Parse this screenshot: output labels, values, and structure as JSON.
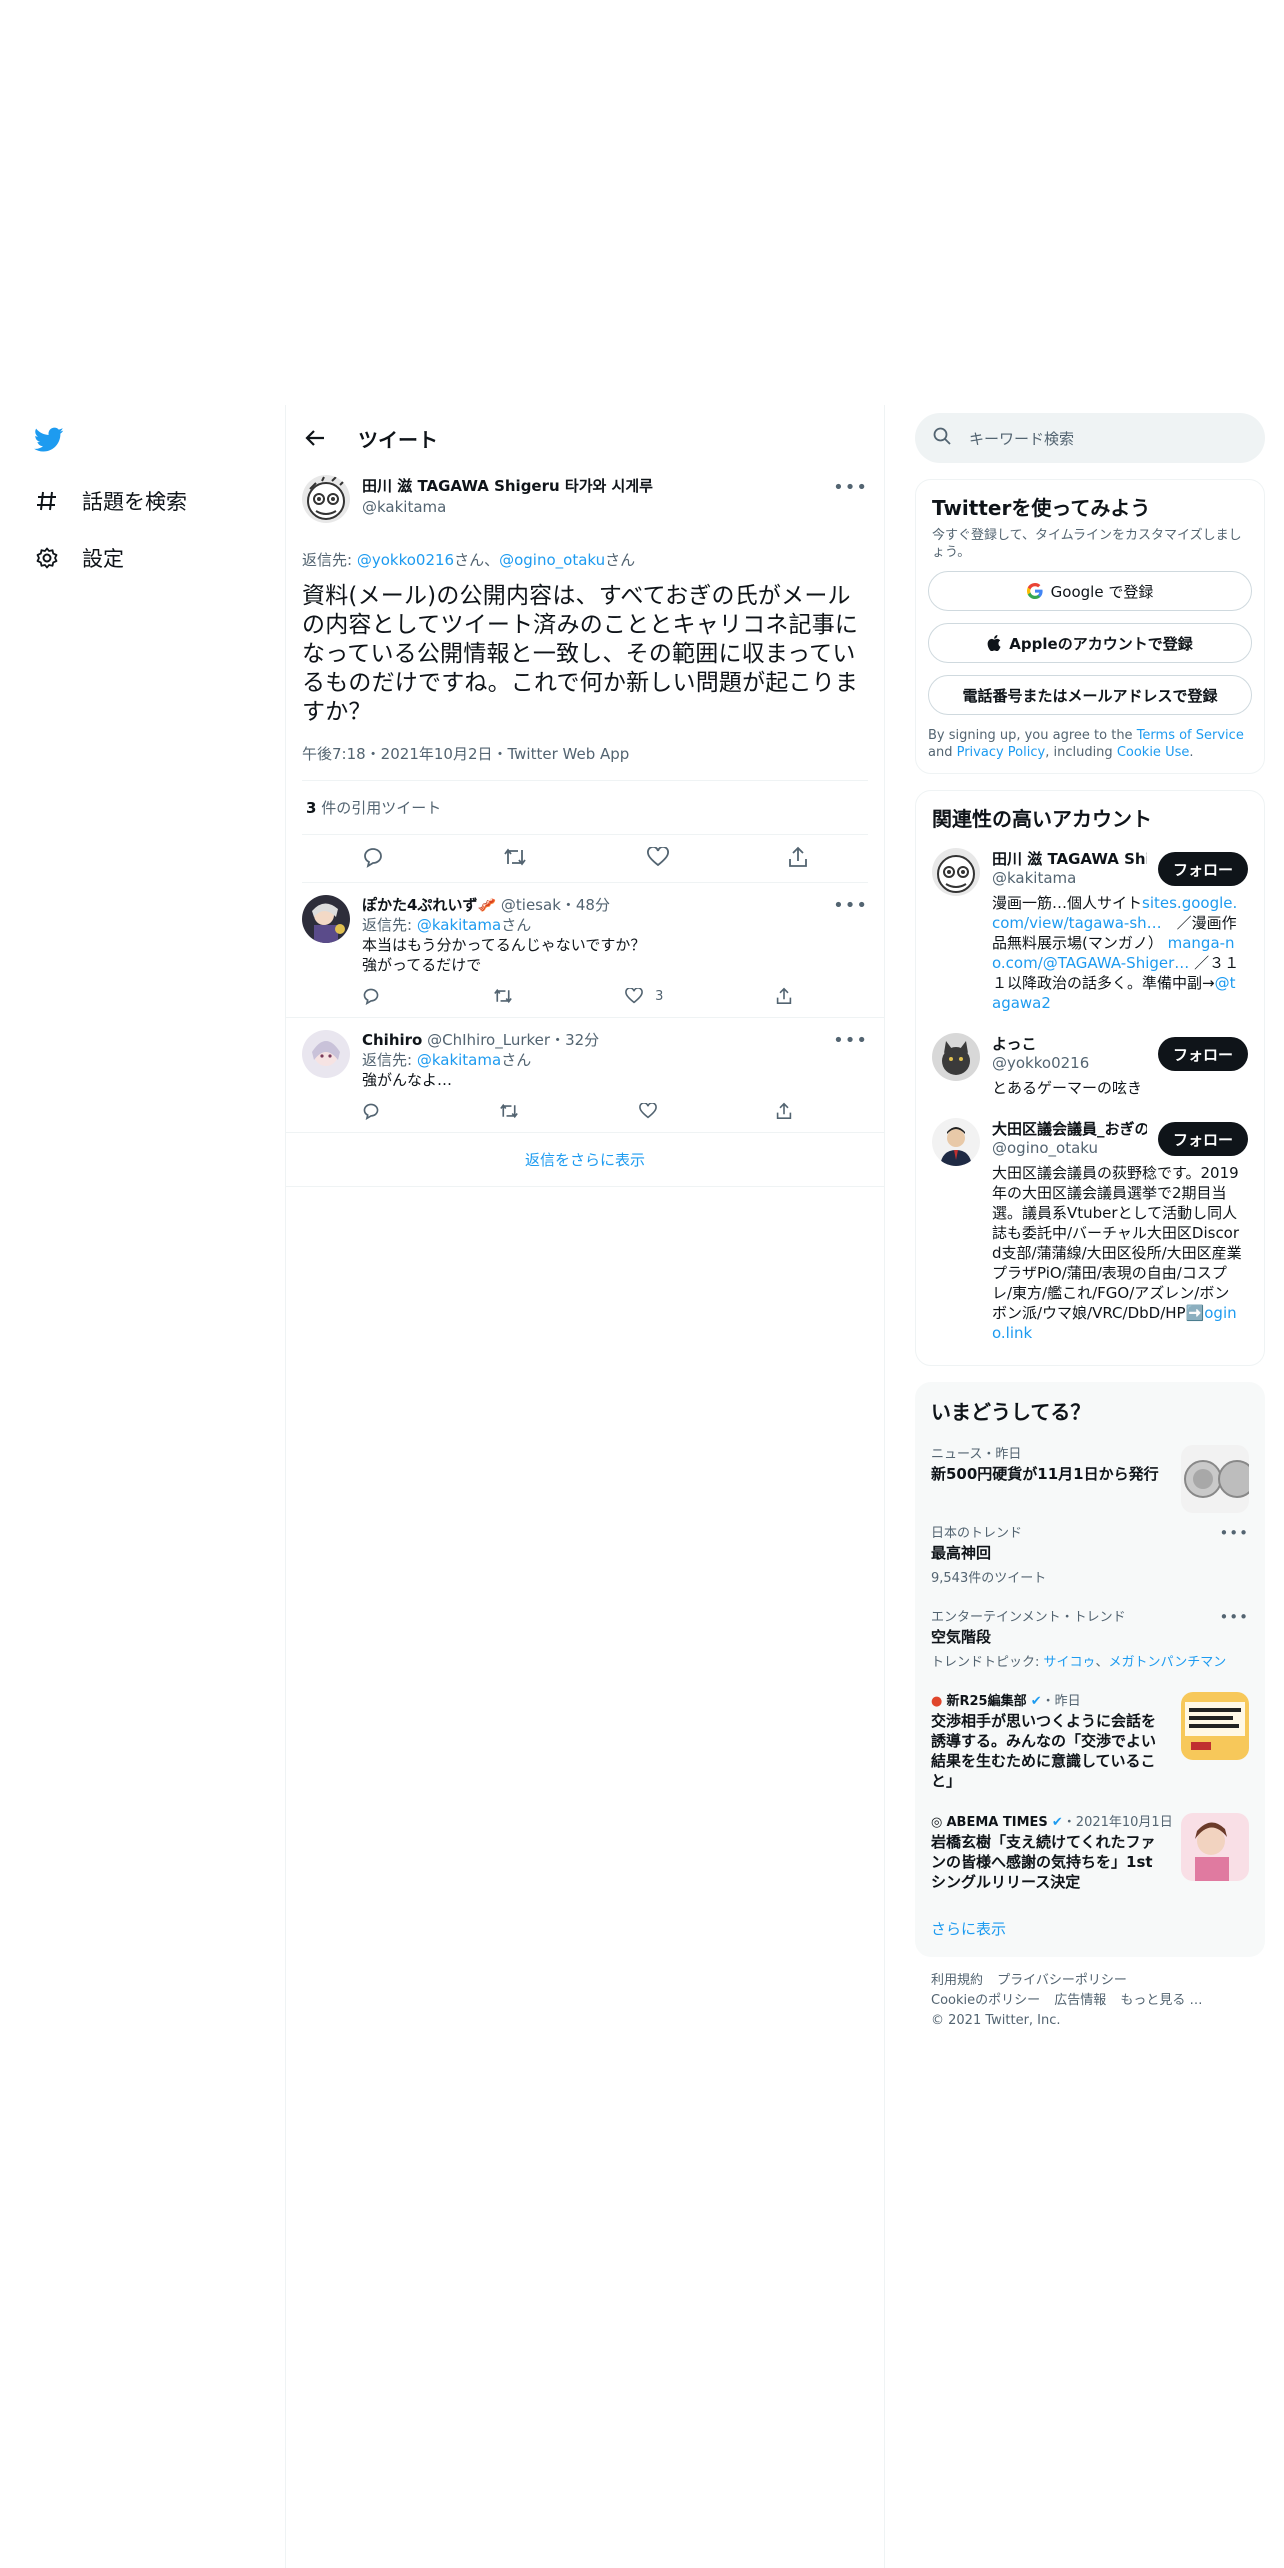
{
  "nav": {
    "explore": "話題を検索",
    "settings": "設定"
  },
  "header": {
    "title": "ツイート"
  },
  "tweet": {
    "author_name": "田川 滋 TAGAWA Shigeru 타가와 시게루",
    "author_handle": "@kakitama",
    "replying_prefix": "返信先: ",
    "replying_to_1": "@yokko0216",
    "replying_san_1": "さん、",
    "replying_to_2": "@ogino_otaku",
    "replying_san_2": "さん",
    "text": "資料(メール)の公開内容は、すべておぎの氏がメールの内容としてツイート済みのこととキャリコネ記事になっている公開情報と一致し、その範囲に収まっているものだけですね。これで何か新しい問題が起こりますか？",
    "timestamp": "午後7:18・2021年10月2日・Twitter Web App",
    "quote_count": "3",
    "quote_label": " 件の引用ツイート"
  },
  "replies": [
    {
      "name": "ぽかた4ぷれいず🥓",
      "handle": "@tiesak",
      "time": "・48分",
      "replying_prefix": "返信先: ",
      "replying_to": "@kakitama",
      "replying_san": "さん",
      "text_1": "本当はもう分かってるんじゃないですか？",
      "text_2": "強がってるだけで",
      "like_count": "3"
    },
    {
      "name": "Chihiro",
      "handle": "@ChIhiro_Lurker",
      "time": "・32分",
      "replying_prefix": "返信先: ",
      "replying_to": "@kakitama",
      "replying_san": "さん",
      "text_1": "強がんなよ…",
      "like_count": ""
    }
  ],
  "show_more_replies": "返信をさらに表示",
  "search": {
    "placeholder": "キーワード検索"
  },
  "signup": {
    "title": "Twitterを使ってみよう",
    "subtitle": "今すぐ登録して、タイムラインをカスタマイズしましょう。",
    "google": "Google で登録",
    "apple": "Appleのアカウントで登録",
    "phone_email": "電話番号またはメールアドレスで登録",
    "legal_1": "By signing up, you agree to the ",
    "terms": "Terms of Service",
    "legal_2": " and ",
    "privacy": "Privacy Policy",
    "legal_3": ", including ",
    "cookie": "Cookie Use",
    "legal_4": "."
  },
  "related": {
    "title": "関連性の高いアカウント",
    "follow_label": "フォロー",
    "accounts": [
      {
        "name": "田川 滋 TAGAWA Shigeru 타가와 시게루",
        "handle": "@kakitama",
        "bio_1": "漫画一筋…個人サイト",
        "bio_link_1": "sites.google.com/view/tagawa-sh…",
        "bio_2": "　／漫画作品無料展示場(マンガノ） ",
        "bio_link_2": "manga-no.com/@TAGAWA-Shiger…",
        "bio_3": " ／３１１以降政治の話多く。準備中副→",
        "bio_link_3": "@tagawa2"
      },
      {
        "name": "よっこ",
        "handle": "@yokko0216",
        "bio_1": "とあるゲーマーの呟き"
      },
      {
        "name": "大田区議会議員_おぎの稔",
        "handle": "@ogino_otaku",
        "bio_1": "大田区議会議員の荻野稔です。2019年の大田区議会議員選挙で2期目当選。議員系Vtuberとして活動し同人誌も委託中/バーチャル大田区Discord支部/蒲蒲線/大田区役所/大田区産業プラザPiO/蒲田/表現の自由/コスプレ/東方/艦これ/FGO/アズレン/ボンボン派/ウマ娘/VRC/DbD/HP➡️",
        "bio_link_1": "ogino.link"
      }
    ]
  },
  "trends": {
    "title": "いまどうしてる？",
    "items": [
      {
        "category": "ニュース・昨日",
        "title": "新500円硬貨が11月1日から発行"
      },
      {
        "category": "日本のトレンド",
        "title": "最高神回",
        "count": "9,543件のツイート"
      },
      {
        "category": "エンターテインメント・トレンド",
        "title": "空気階段",
        "topic_prefix": "トレンドトピック: ",
        "topic_1": "サイコゥ",
        "topic_sep": "、",
        "topic_2": "メガトンパンチマン"
      },
      {
        "source": "新R25編集部",
        "time": "・昨日",
        "title": "交渉相手が思いつくように会話を誘導する。みんなの「交渉でよい結果を生むために意識していること」"
      },
      {
        "source": "ABEMA TIMES",
        "time": "・2021年10月1日",
        "title": "岩橋玄樹「支え続けてくれたファンの皆様へ感謝の気持ちを」1stシングルリリース決定"
      }
    ],
    "show_more": "さらに表示"
  },
  "footer": {
    "terms": "利用規約",
    "privacy": "プライバシーポリシー",
    "cookie": "Cookieのポリシー",
    "ads": "広告情報",
    "more": "もっと見る …",
    "copyright": "© 2021 Twitter, Inc."
  },
  "colors": {
    "accent": "#1d9bf0",
    "text": "#0f1419",
    "muted": "#536471",
    "border": "#eff3f4"
  }
}
